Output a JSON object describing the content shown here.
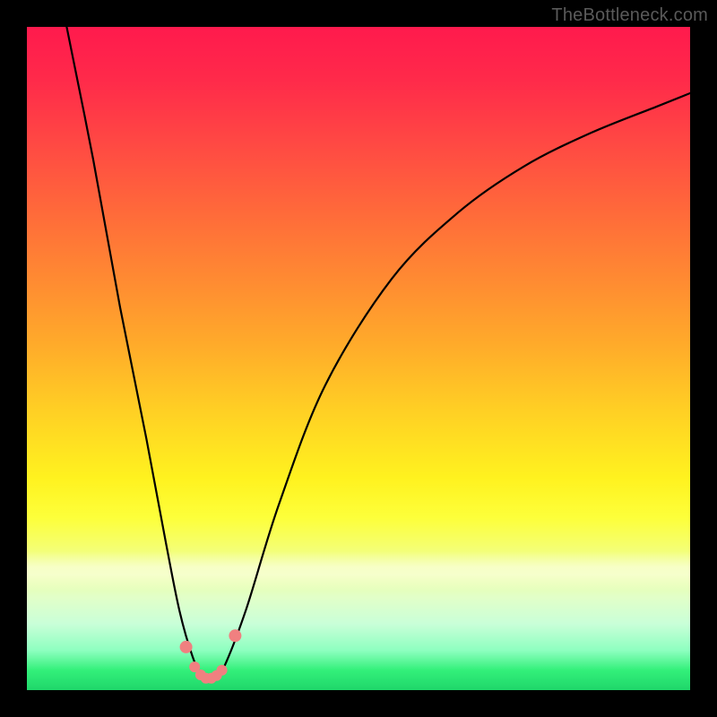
{
  "watermark": "TheBottleneck.com",
  "colors": {
    "curve": "#000000",
    "marker": "#f08080",
    "background_black": "#000000"
  },
  "chart_data": {
    "type": "line",
    "title": "",
    "xlabel": "",
    "ylabel": "",
    "xlim": [
      0,
      100
    ],
    "ylim": [
      0,
      100
    ],
    "grid": false,
    "legend": false,
    "series": [
      {
        "name": "bottleneck-curve",
        "x": [
          6,
          10,
          14,
          18,
          21,
          23,
          25,
          26.5,
          28,
          29.5,
          33,
          38,
          45,
          55,
          65,
          75,
          85,
          95,
          100
        ],
        "values": [
          100,
          80,
          58,
          38,
          22,
          12,
          5,
          2,
          1.5,
          3,
          12,
          28,
          46,
          62,
          72,
          79,
          84,
          88,
          90
        ]
      }
    ],
    "markers": {
      "name": "highlighted-points",
      "x": [
        24.0,
        25.3,
        26.2,
        27.0,
        27.8,
        28.6,
        29.4,
        31.4
      ],
      "values": [
        6.5,
        3.5,
        2.3,
        1.8,
        1.8,
        2.2,
        3.0,
        8.2
      ]
    },
    "annotations": []
  }
}
